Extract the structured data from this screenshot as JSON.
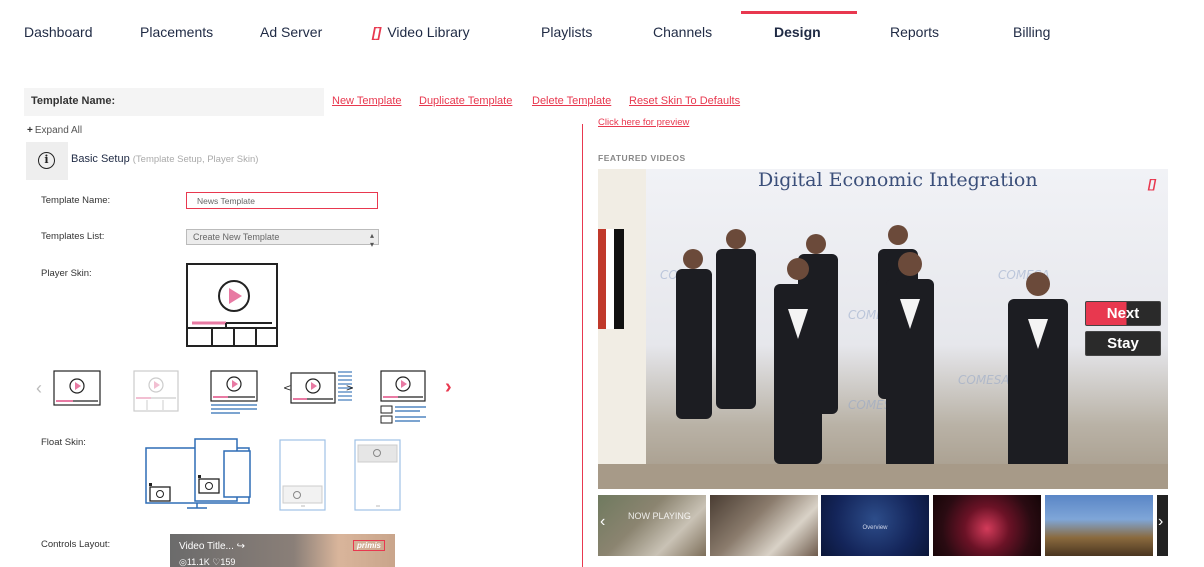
{
  "nav": {
    "items": [
      {
        "label": "Dashboard"
      },
      {
        "label": "Placements"
      },
      {
        "label": "Ad Server"
      },
      {
        "label": "Video Library",
        "prefix": "[]"
      },
      {
        "label": "Playlists"
      },
      {
        "label": "Channels"
      },
      {
        "label": "Design",
        "active": true
      },
      {
        "label": "Reports"
      },
      {
        "label": "Billing"
      }
    ]
  },
  "toolbar": {
    "template_name_label": "Template Name:",
    "new_template": "New Template",
    "duplicate_template": "Duplicate Template",
    "delete_template": "Delete Template",
    "reset_skin": "Reset Skin To Defaults",
    "preview_link": "Click here for preview"
  },
  "panel": {
    "expand_all": "Expand All",
    "section_title": "Basic Setup",
    "section_subtitle": "(Template Setup, Player Skin)",
    "template_name_label": "Template Name:",
    "template_name_value": "News Template",
    "templates_list_label": "Templates List:",
    "templates_list_value": "Create New Template",
    "player_skin_label": "Player Skin:",
    "float_skin_label": "Float Skin:",
    "controls_layout_label": "Controls Layout:",
    "controls_preview": {
      "title": "Video Title...",
      "views": "11.1K",
      "likes": "159",
      "brand": "primis"
    }
  },
  "preview": {
    "featured_label": "FEATURED VIDEOS",
    "headline": "Digital Economic Integration",
    "brand_mark": "[]",
    "next_label": "Next",
    "stay_label": "Stay",
    "thumbnails": [
      {
        "label": "NOW PLAYING"
      },
      {
        "label": ""
      },
      {
        "label": "Overview"
      },
      {
        "label": ""
      },
      {
        "label": ""
      }
    ]
  },
  "colors": {
    "accent": "#e8384f",
    "text": "#1f2a44",
    "skin_blue": "#2f6db5"
  }
}
